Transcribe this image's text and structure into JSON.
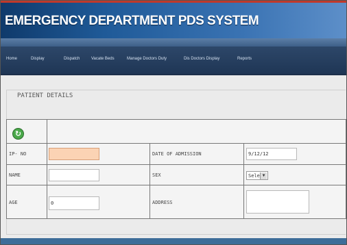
{
  "app": {
    "title": "EMERGENCY DEPARTMENT PDS SYSTEM"
  },
  "menu": [
    {
      "label": "Home"
    },
    {
      "label": "Display"
    },
    {
      "label": "Dispatch"
    },
    {
      "label": "Vacate Beds"
    },
    {
      "label": "Manage Doctors Duty"
    },
    {
      "label": "Dis Doctors Display"
    },
    {
      "label": "Reports"
    }
  ],
  "section": {
    "legend": "PATIENT DETAILS"
  },
  "form": {
    "ip_no_label": "IP- NO",
    "ip_no_value": "",
    "date_label": "DATE OF ADMISSION",
    "date_value": "9/12/12",
    "name_label": "NAME",
    "name_value": "",
    "sex_label": "SEX",
    "sex_value": "Select",
    "age_label": "AGE",
    "age_value": "0",
    "address_label": "ADDRESS",
    "address_value": ""
  },
  "colors": {
    "header": "#1f5a98",
    "menubar": "#2d4769",
    "focus_field": "#fbd3b4",
    "refresh": "#4aa84a"
  },
  "icons": {
    "refresh": "refresh-icon"
  }
}
